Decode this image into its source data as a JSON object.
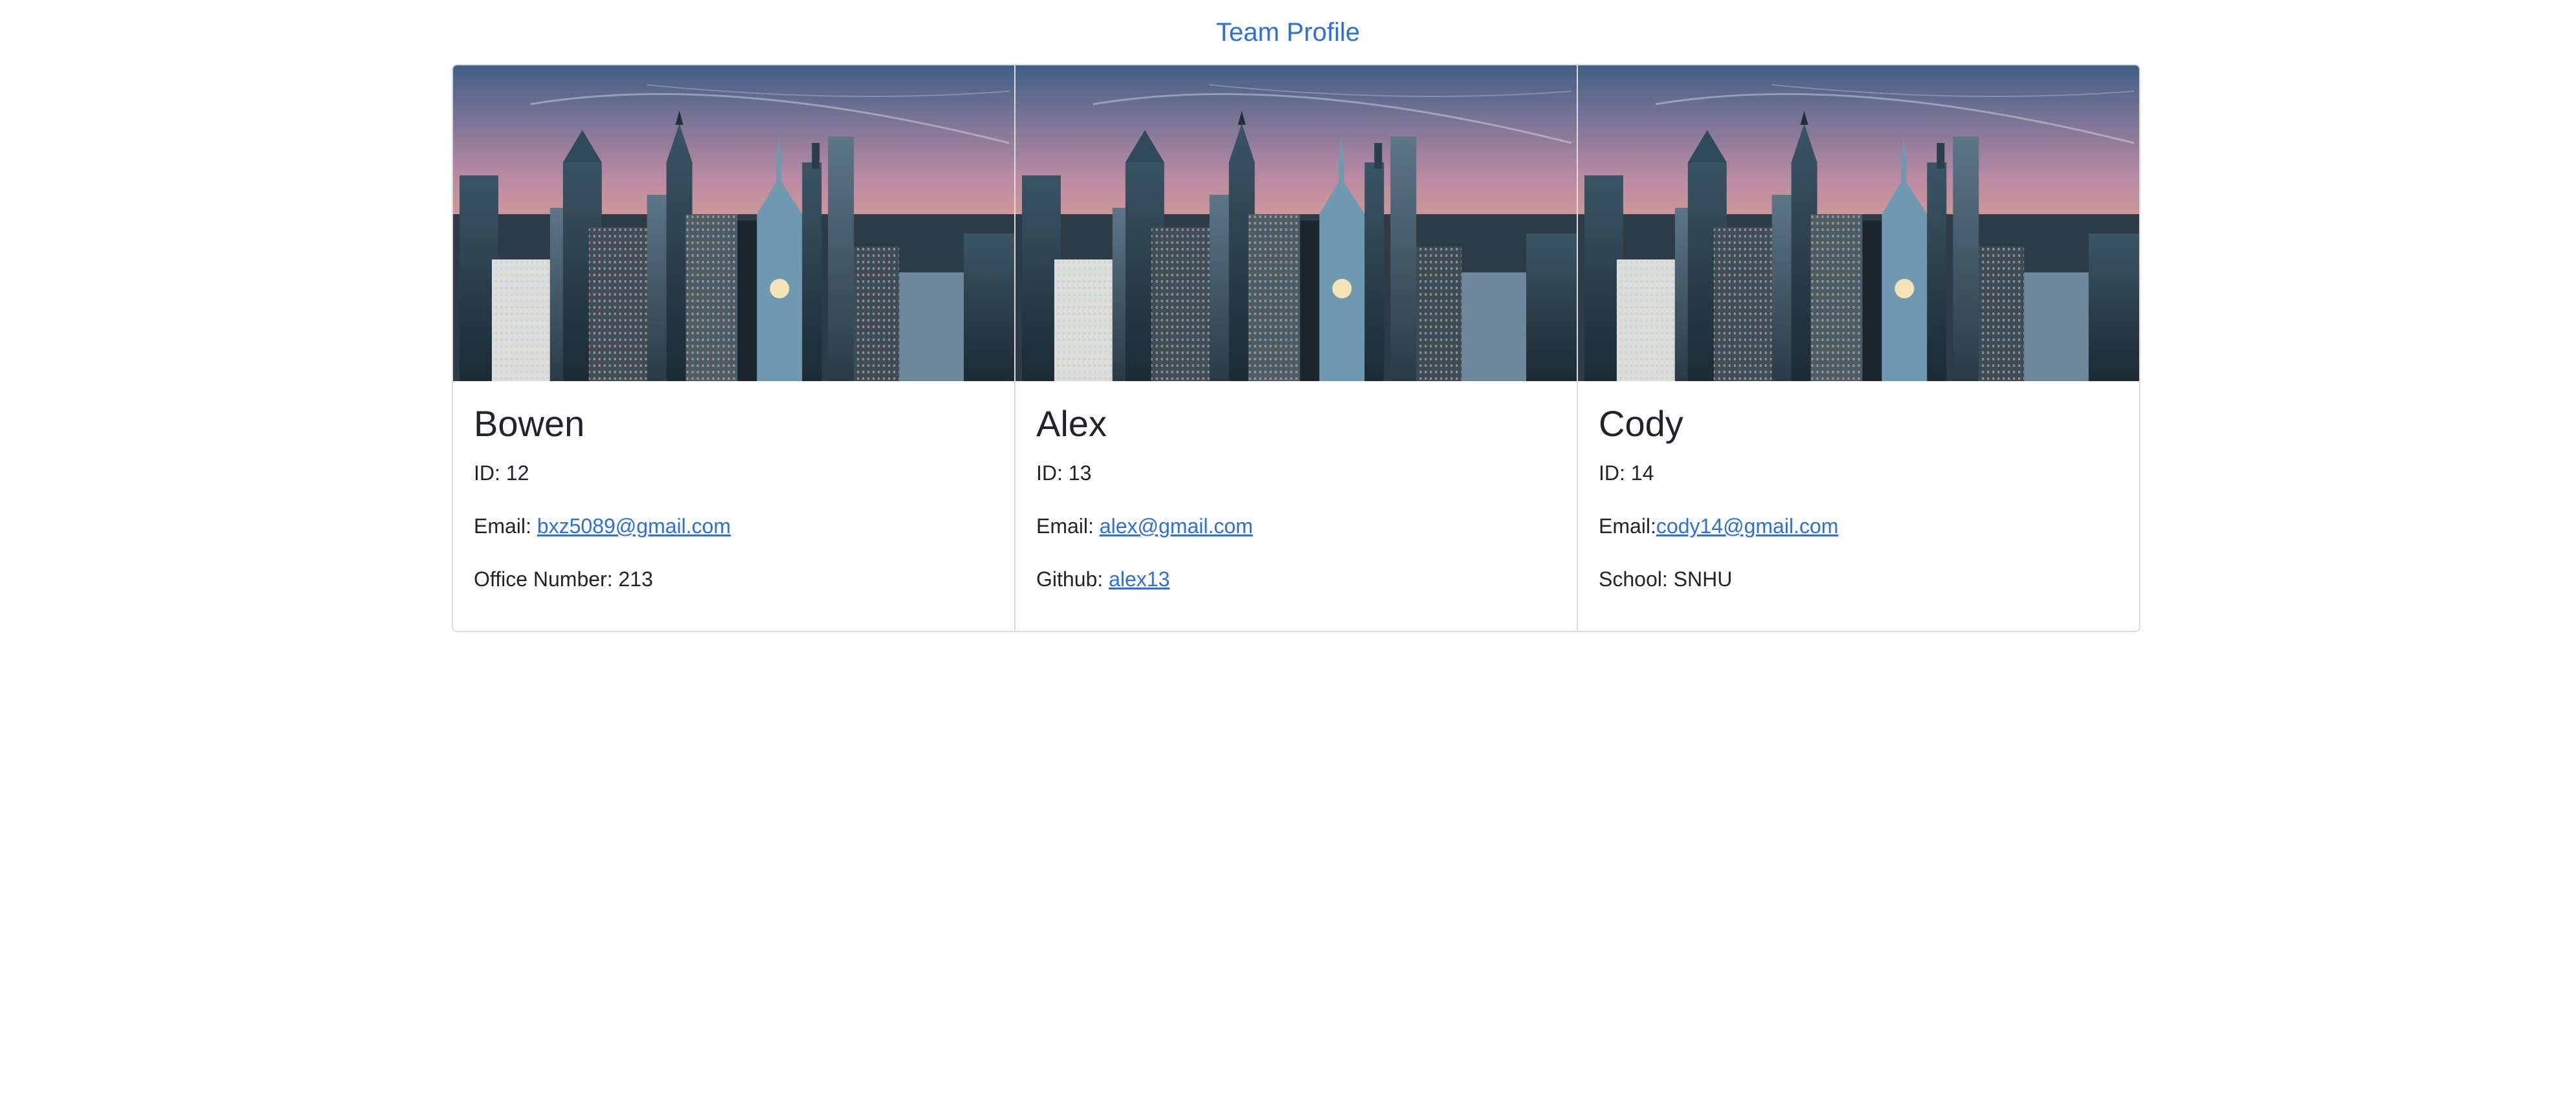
{
  "page": {
    "title": "Team Profile"
  },
  "colors": {
    "accent": "#2b6fe0",
    "text": "#212529",
    "border": "#dcdcdc"
  },
  "cards": [
    {
      "image": "city-skyline-image",
      "name": "Bowen",
      "id_label": "ID: 12",
      "email_prefix": "Email: ",
      "email": "bxz5089@gmail.com",
      "extra_label": "Office Number: 213"
    },
    {
      "image": "city-skyline-image",
      "name": "Alex",
      "id_label": "ID: 13",
      "email_prefix": "Email: ",
      "email": "alex@gmail.com",
      "github_prefix": "Github: ",
      "github": "alex13"
    },
    {
      "image": "city-skyline-image",
      "name": "Cody",
      "id_label": "ID: 14",
      "email_prefix": "Email:",
      "email": "cody14@gmail.com",
      "extra_label": "School: SNHU"
    }
  ]
}
